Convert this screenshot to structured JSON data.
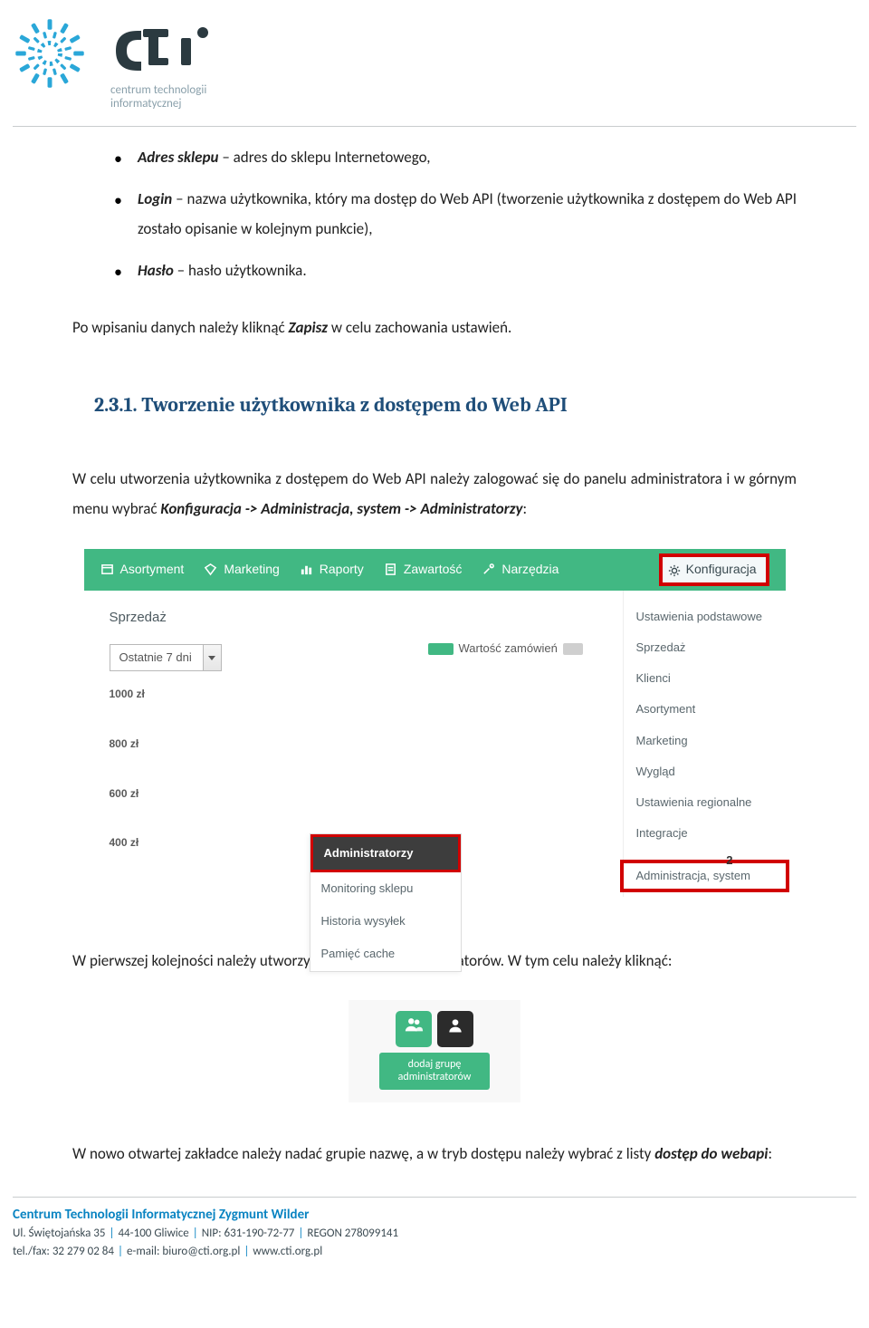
{
  "logo": {
    "brand_line1": "cti",
    "sub_line1": "centrum technologii",
    "sub_line2": "informatycznej"
  },
  "bullets": [
    {
      "term": "Adres sklepu",
      "rest": " – adres do sklepu Internetowego,"
    },
    {
      "term": "Login",
      "rest": " – nazwa użytkownika, który ma dostęp do Web API (tworzenie użytkownika z dostępem do Web API zostało opisanie w kolejnym punkcie),"
    },
    {
      "term": "Hasło",
      "rest": " – hasło użytkownika."
    }
  ],
  "save_para_pre": "Po wpisaniu danych należy kliknąć ",
  "save_para_em": "Zapisz",
  "save_para_post": " w celu zachowania ustawień.",
  "section_heading": "2.3.1. Tworzenie użytkownika z dostępem do Web API",
  "intro_para_pre": "W celu utworzenia użytkownika z dostępem do Web API należy zalogować się do panelu administratora i w górnym menu wybrać ",
  "intro_para_em": "Konfiguracja -> Administracja, system -> Administratorzy",
  "intro_para_post": ":",
  "shot1": {
    "menu": [
      "Asortyment",
      "Marketing",
      "Raporty",
      "Zawartość",
      "Narzędzia"
    ],
    "konfiguracja": "Konfiguracja",
    "panel_title": "Sprzedaż",
    "dropdown": "Ostatnie 7 dni",
    "legend": "Wartość zamówień",
    "yticks": [
      "1000 zł",
      "800 zł",
      "600 zł",
      "400 zł"
    ],
    "right_menu": [
      "Ustawienia podstawowe",
      "Sprzedaż",
      "Klienci",
      "Asortyment",
      "Marketing",
      "Wygląd",
      "Ustawienia regionalne",
      "Integracje"
    ],
    "right_menu_hl": "Administracja, system",
    "submenu": [
      "Administratorzy",
      "Monitoring sklepu",
      "Historia wysyłek",
      "Pamięć cache"
    ],
    "num": "2"
  },
  "after_shot1": "W pierwszej kolejności należy utworzyć nową grupę administratorów. W tym celu należy kliknąć:",
  "shot2": {
    "tooltip_l1": "dodaj grupę",
    "tooltip_l2": "administratorów"
  },
  "closing_pre": "W nowo otwartej zakładce należy nadać grupie nazwę, a w tryb dostępu należy wybrać z listy ",
  "closing_em": "dostęp do webapi",
  "closing_post": ":",
  "footer": {
    "company": "Centrum Technologii Informatycznej",
    "owner": " Zygmunt Wilder",
    "addr": "Ul. Świętojańska 35",
    "city": "44-100 Gliwice",
    "nip_label": "NIP: ",
    "nip": "631-190-72-77",
    "regon_label": "REGON ",
    "regon": "278099141",
    "tel_label": "tel./fax: ",
    "tel": "32 279 02 84",
    "email_label": "e-mail: ",
    "email": "biuro@cti.org.pl",
    "www": "www.cti.org.pl"
  }
}
